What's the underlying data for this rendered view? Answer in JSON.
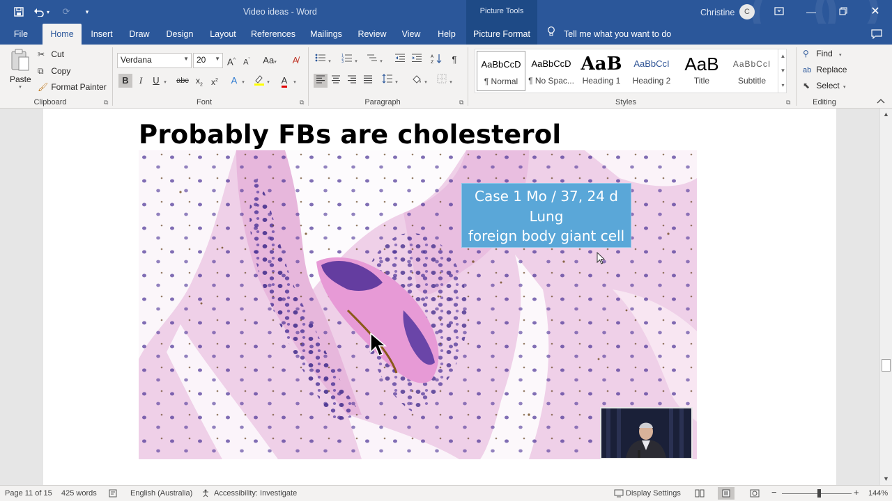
{
  "titlebar": {
    "doc_title": "Video ideas  -  Word",
    "picture_tools": "Picture Tools",
    "user_name": "Christine",
    "user_initial": "C"
  },
  "tabs": {
    "file": "File",
    "home": "Home",
    "insert": "Insert",
    "draw": "Draw",
    "design": "Design",
    "layout": "Layout",
    "references": "References",
    "mailings": "Mailings",
    "review": "Review",
    "view": "View",
    "help": "Help",
    "picture_format": "Picture Format",
    "tell_me": "Tell me what you want to do"
  },
  "clipboard": {
    "paste": "Paste",
    "cut": "Cut",
    "copy": "Copy",
    "format_painter": "Format Painter",
    "label": "Clipboard"
  },
  "font": {
    "name": "Verdana",
    "size": "20",
    "label": "Font"
  },
  "paragraph": {
    "label": "Paragraph"
  },
  "styles": {
    "label": "Styles",
    "items": [
      {
        "preview": "AaBbCcD",
        "name": "¶ Normal"
      },
      {
        "preview": "AaBbCcD",
        "name": "¶ No Spac..."
      },
      {
        "preview": "AaB",
        "name": "Heading 1"
      },
      {
        "preview": "AaBbCcI",
        "name": "Heading 2"
      },
      {
        "preview": "AaB",
        "name": "Title"
      },
      {
        "preview": "AaBbCcI",
        "name": "Subtitle"
      }
    ]
  },
  "editing": {
    "find": "Find",
    "replace": "Replace",
    "select": "Select",
    "label": "Editing"
  },
  "document": {
    "heading": "Probably FBs are cholesterol",
    "caption_lines": [
      "Case 1 Mo / 37, 24 d",
      "Lung",
      "foreign body giant cell"
    ]
  },
  "status": {
    "page": "Page 11 of 15",
    "words": "425 words",
    "language": "English (Australia)",
    "accessibility": "Accessibility: Investigate",
    "display_settings": "Display Settings",
    "zoom": "144%"
  },
  "colors": {
    "word_blue": "#2b579a",
    "picture_tools": "#1e4a86",
    "caption_box": "#5aa7d8"
  }
}
